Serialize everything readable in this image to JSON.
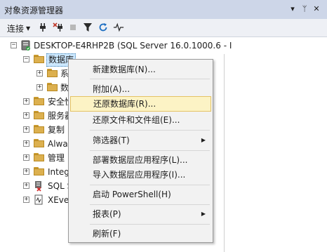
{
  "window": {
    "title": "对象资源管理器",
    "buttons": [
      "▾",
      "ᛘ",
      "✕"
    ]
  },
  "toolbar": {
    "connect_label": "连接",
    "tools": [
      "connect-plug-icon",
      "disconnect-icon",
      "stop-icon",
      "filter-icon",
      "refresh-icon",
      "activity-monitor-icon"
    ]
  },
  "tree": {
    "server": "DESKTOP-E4RHP2B (SQL Server 16.0.1000.6 - I",
    "nodes": [
      {
        "label": "数据库",
        "truncated": true
      },
      {
        "label": "系"
      },
      {
        "label": "数"
      },
      {
        "label": "安全性"
      },
      {
        "label": "服务器"
      },
      {
        "label": "复制"
      },
      {
        "label": "Alway"
      },
      {
        "label": "管理"
      },
      {
        "label": "Integ"
      },
      {
        "label": "SQL S"
      },
      {
        "label": "XEve"
      }
    ]
  },
  "context_menu": {
    "items": [
      {
        "label": "新建数据库(N)...",
        "has_submenu": false
      },
      {
        "label": "附加(A)...",
        "has_submenu": false
      },
      {
        "label": "还原数据库(R)...",
        "has_submenu": false,
        "highlighted": true
      },
      {
        "label": "还原文件和文件组(E)...",
        "has_submenu": false
      },
      {
        "label": "筛选器(T)",
        "has_submenu": true
      },
      {
        "label": "部署数据层应用程序(L)...",
        "has_submenu": false
      },
      {
        "label": "导入数据层应用程序(I)...",
        "has_submenu": false
      },
      {
        "label": "启动 PowerShell(H)",
        "has_submenu": false
      },
      {
        "label": "报表(P)",
        "has_submenu": true
      },
      {
        "label": "刷新(F)",
        "has_submenu": false
      }
    ]
  },
  "colors": {
    "titlebar": "#cdd6e8",
    "menu_highlight": "#fcf3c5",
    "selection": "#cce8ff"
  }
}
